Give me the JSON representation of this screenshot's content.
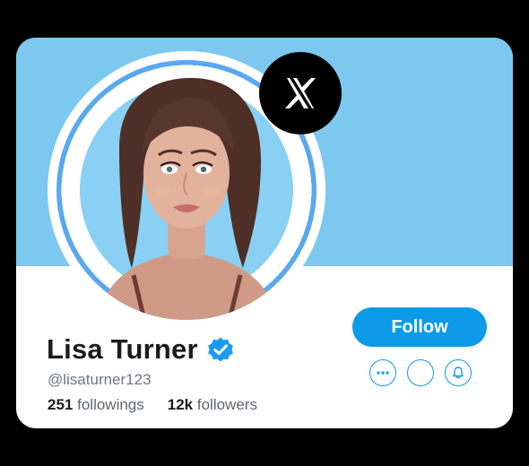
{
  "profile": {
    "name": "Lisa Turner",
    "handle": "@lisaturner123",
    "following_count": "251",
    "following_label": "followings",
    "followers_count": "12k",
    "followers_label": "followers"
  },
  "actions": {
    "follow_label": "Follow",
    "more_icon": "more-dots-icon",
    "blank_icon": "empty-circle-icon",
    "notify_icon": "bell-icon"
  },
  "colors": {
    "banner": "#7cc8ef",
    "accent": "#0d9ae8",
    "verified": "#1d9bf0"
  }
}
